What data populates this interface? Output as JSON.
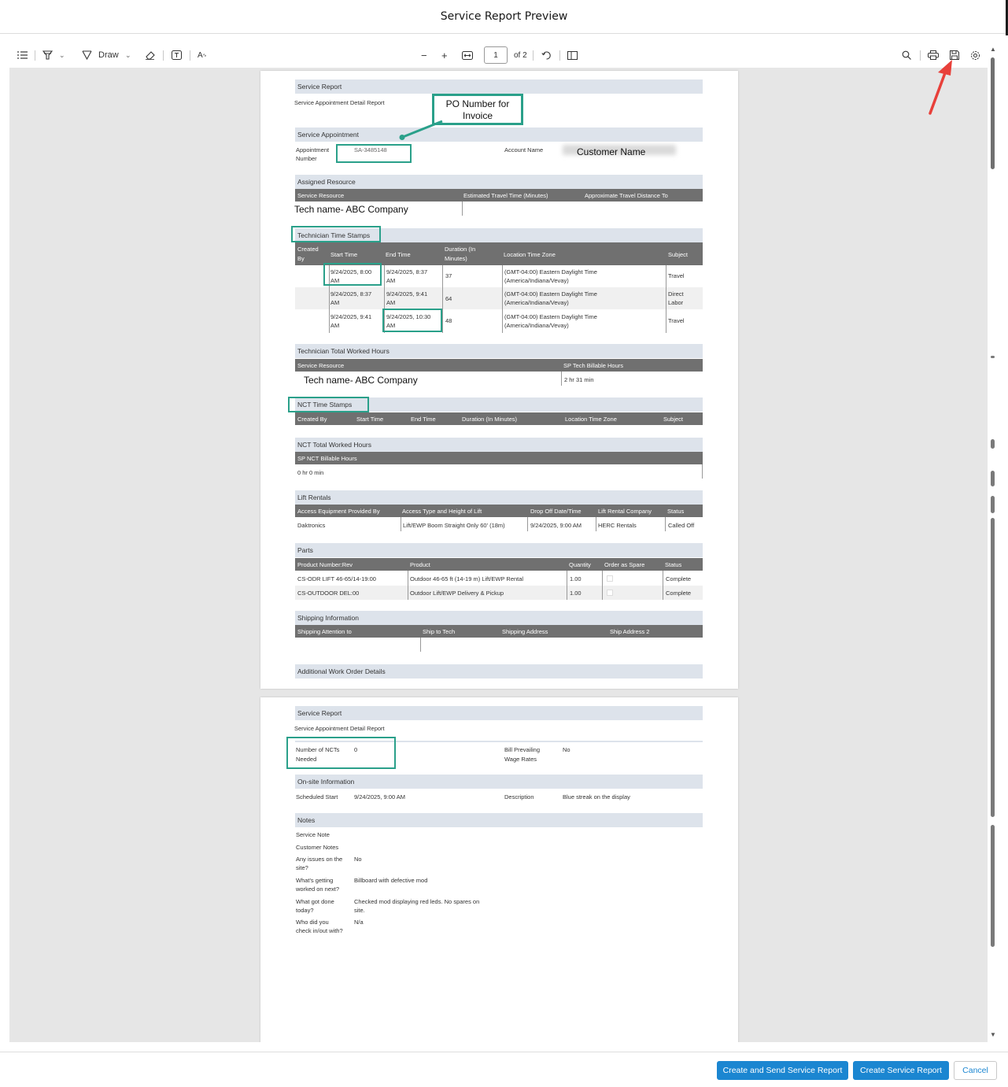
{
  "modal": {
    "title": "Service Report Preview"
  },
  "toolbar": {
    "draw_label": "Draw",
    "page_number": "1",
    "page_total": "of 2",
    "icons": [
      "contents-icon",
      "highlight-icon",
      "draw-icon",
      "eraser-icon",
      "textbox-icon",
      "read-aloud-icon",
      "zoom-out-icon",
      "zoom-in-icon",
      "fit-width-icon",
      "rotate-icon",
      "page-view-icon",
      "search-icon",
      "print-icon",
      "save-icon",
      "settings-icon"
    ]
  },
  "annotations": {
    "po_callout": "PO Number for Invoice",
    "customer_name": "Customer Name",
    "tech_name_1": "Tech name- ABC Company",
    "tech_name_2": "Tech name- ABC Company",
    "highlight_color": "#2aa08a",
    "arrow_color": "#e8403a"
  },
  "page1": {
    "report_title": "Service Report",
    "report_subtitle": "Service Appointment Detail Report",
    "service_appointment": {
      "heading": "Service Appointment",
      "appt_label_1": "Appointment",
      "appt_label_2": "Number",
      "appt_value": "SA-3485148",
      "account_label": "Account Name"
    },
    "assigned_resource": {
      "heading": "Assigned Resource",
      "columns": [
        "Service Resource",
        "Estimated Travel Time (Minutes)",
        "Approximate Travel Distance To"
      ]
    },
    "tech_time_stamps": {
      "heading": "Technician Time Stamps",
      "columns": {
        "created_by_1": "Created",
        "created_by_2": "By",
        "start": "Start Time",
        "end": "End Time",
        "duration_1": "Duration (In",
        "duration_2": "Minutes)",
        "timezone": "Location Time Zone",
        "subject": "Subject"
      },
      "rows": [
        {
          "start_1": "9/24/2025, 8:00",
          "start_2": "AM",
          "end_1": "9/24/2025, 8:37",
          "end_2": "AM",
          "duration": "37",
          "tz_1": "(GMT-04:00) Eastern Daylight Time",
          "tz_2": "(America/Indiana/Vevay)",
          "subject_1": "Travel",
          "subject_2": ""
        },
        {
          "start_1": "9/24/2025, 8:37",
          "start_2": "AM",
          "end_1": "9/24/2025, 9:41",
          "end_2": "AM",
          "duration": "64",
          "tz_1": "(GMT-04:00) Eastern Daylight Time",
          "tz_2": "(America/Indiana/Vevay)",
          "subject_1": "Direct",
          "subject_2": "Labor"
        },
        {
          "start_1": "9/24/2025, 9:41",
          "start_2": "AM",
          "end_1": "9/24/2025, 10:30",
          "end_2": "AM",
          "duration": "48",
          "tz_1": "(GMT-04:00) Eastern Daylight Time",
          "tz_2": "(America/Indiana/Vevay)",
          "subject_1": "Travel",
          "subject_2": ""
        }
      ]
    },
    "tech_total": {
      "heading": "Technician Total Worked Hours",
      "col_resource": "Service Resource",
      "col_hours": "SP Tech Billable Hours",
      "hours_value": "2 hr 31 min"
    },
    "nct_time_stamps": {
      "heading": "NCT Time Stamps",
      "columns": [
        "Created By",
        "Start Time",
        "End Time",
        "Duration (In Minutes)",
        "Location Time Zone",
        "Subject"
      ]
    },
    "nct_total": {
      "heading": "NCT Total Worked Hours",
      "col_hours": "SP NCT Billable Hours",
      "hours_value": "0 hr 0 min"
    },
    "lift_rentals": {
      "heading": "Lift Rentals",
      "columns": [
        "Access Equipment Provided By",
        "Access Type and Height of Lift",
        "Drop Off Date/Time",
        "Lift Rental Company",
        "Status"
      ],
      "row": [
        "Daktronics",
        "Lift/EWP Boom Straight Only 60' (18m)",
        "9/24/2025, 9:00 AM",
        "HERC Rentals",
        "Called Off"
      ]
    },
    "parts": {
      "heading": "Parts",
      "columns": [
        "Product Number:Rev",
        "Product",
        "Quantity",
        "Order as Spare",
        "Status"
      ],
      "rows": [
        [
          "CS-ODR LIFT 46-65/14-19:00",
          "Outdoor 46-65 ft (14-19 m) Lift/EWP Rental",
          "1.00",
          "Complete"
        ],
        [
          "CS-OUTDOOR DEL:00",
          "Outdoor Lift/EWP Delivery & Pickup",
          "1.00",
          "Complete"
        ]
      ]
    },
    "shipping": {
      "heading": "Shipping Information",
      "columns": [
        "Shipping Attention to",
        "Ship to Tech",
        "Shipping Address",
        "Ship Address 2"
      ]
    },
    "additional_heading": "Additional Work Order Details"
  },
  "page2": {
    "report_title": "Service Report",
    "report_subtitle": "Service Appointment Detail Report",
    "nct_needed_1": "Number of NCTs",
    "nct_needed_2": "Needed",
    "nct_needed_value": "0",
    "bill_wage_1": "Bill Prevailing",
    "bill_wage_2": "Wage Rates",
    "bill_wage_value": "No",
    "onsite": {
      "heading": "On-site Information",
      "scheduled_label": "Scheduled Start",
      "scheduled_value": "9/24/2025, 9:00 AM",
      "description_label": "Description",
      "description_value": "Blue streak on the display"
    },
    "notes": {
      "heading": "Notes",
      "service_note": "Service Note",
      "customer_notes": "Customer Notes",
      "issues_1": "Any issues on the",
      "issues_2": "site?",
      "issues_value": "No",
      "next_1": "What's getting",
      "next_2": "worked on next?",
      "next_value": "Billboard with defective mod",
      "done_1": "What got done",
      "done_2": "today?",
      "done_value_1": "Checked mod displaying red leds. No spares on",
      "done_value_2": "site.",
      "checkin_1": "Who did you",
      "checkin_2": "check in/out with?",
      "checkin_value": "N/a"
    }
  },
  "footer": {
    "create_send_label": "Create and Send Service Report",
    "create_label": "Create Service Report",
    "cancel_label": "Cancel"
  }
}
